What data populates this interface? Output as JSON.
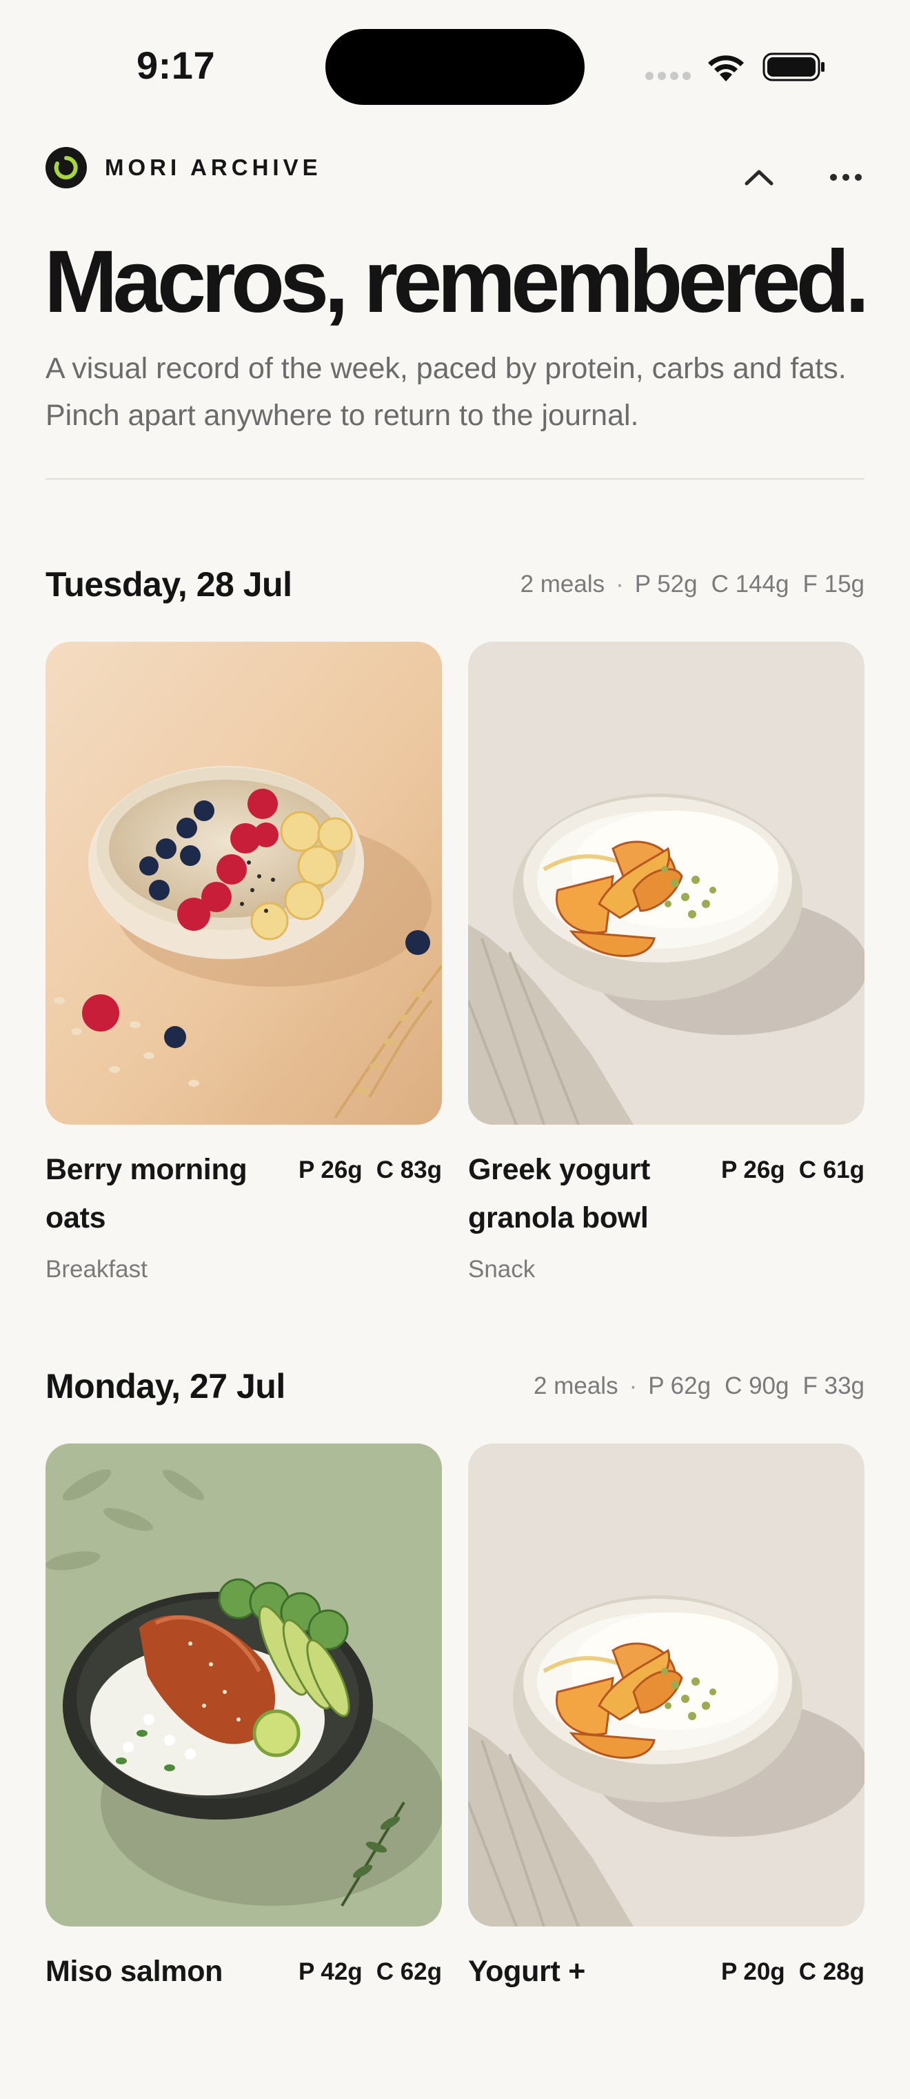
{
  "status_bar": {
    "time": "9:17"
  },
  "header": {
    "brand": "MORI ARCHIVE"
  },
  "hero": {
    "title": "Macros, remembered.",
    "subtitle": "A visual record of the week, paced by protein, carbs and fats. Pinch apart anywhere to return to the journal."
  },
  "days": [
    {
      "title": "Tuesday, 28 Jul",
      "meals_count": "2 meals",
      "separator": "·",
      "protein": "P 52g",
      "carbs": "C 144g",
      "fat": "F 15g",
      "meals": [
        {
          "name": "Berry morning oats",
          "protein": "P 26g",
          "carbs": "C 83g",
          "type": "Breakfast",
          "photo": "oat-bowl-berries-banana"
        },
        {
          "name": "Greek yogurt granola bowl",
          "protein": "P 26g",
          "carbs": "C 61g",
          "type": "Snack",
          "photo": "yogurt-bowl-peaches"
        }
      ]
    },
    {
      "title": "Monday, 27 Jul",
      "meals_count": "2 meals",
      "separator": "·",
      "protein": "P 62g",
      "carbs": "C 90g",
      "fat": "F 33g",
      "meals": [
        {
          "name": "Miso salmon",
          "protein": "P 42g",
          "carbs": "C 62g",
          "type": "",
          "photo": "salmon-rice-bowl"
        },
        {
          "name": "Yogurt +",
          "protein": "P 20g",
          "carbs": "C 28g",
          "type": "",
          "photo": "yogurt-bowl-peaches"
        }
      ]
    }
  ],
  "colors": {
    "background": "#f8f7f4",
    "accent": "#a9d63c",
    "text": "#141414",
    "muted": "#7a7a7a"
  }
}
